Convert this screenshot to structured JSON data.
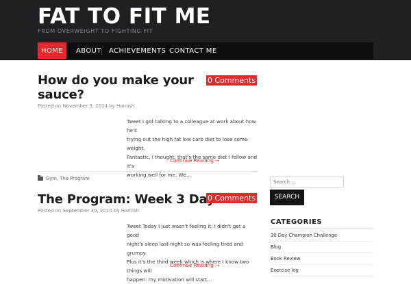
{
  "site": {
    "title": "FAT TO FIT ME",
    "tagline": "FROM OVERWEIGHT TO FIGHTING FIT"
  },
  "nav": {
    "items": [
      {
        "label": "HOME",
        "active": true
      },
      {
        "label": "ABOUT",
        "active": false
      },
      {
        "label": "ACHIEVEMENTS",
        "active": false
      },
      {
        "label": "CONTACT ME",
        "active": false
      }
    ]
  },
  "posts": [
    {
      "title_line1": "How do you make your",
      "title_line2": "sauce?",
      "comments": "0 Comments",
      "meta": "Posted on November 3, 2014 by Hamish",
      "excerpt": [
        "Tweet I got talking to a colleague at work about how he's",
        "trying out the high fat low carb diet to lose some weight.",
        "Fantastic, I thought, that's the same diet I follow and it's",
        "working well for me. We…"
      ],
      "more": "Continue Reading →",
      "categories": "Gym, The Program"
    },
    {
      "title_line1": "The Program: Week 3 Day 2",
      "comments": "0 Comments",
      "meta": "Posted on September 30, 2014 by Hamish",
      "excerpt": [
        "Tweet Today I just wasn't feeling it. I didn't get a good",
        "night's sleep last night so was feeling tired and grumpy.",
        "Plus it's the third week which is where I know two things will",
        "happen: my motivation will start…"
      ],
      "more": "Continue Reading →"
    }
  ],
  "sidebar": {
    "search_placeholder": "Search …",
    "search_button": "SEARCH",
    "categories_title": "CATEGORIES",
    "categories": [
      "30 Day Champion Challenge",
      "Blog",
      "Book Review",
      "Exercise log"
    ]
  },
  "colors": {
    "accent": "#e8282a",
    "header_bg": "#1f2024",
    "nav_bg": "#0d0d0e"
  }
}
